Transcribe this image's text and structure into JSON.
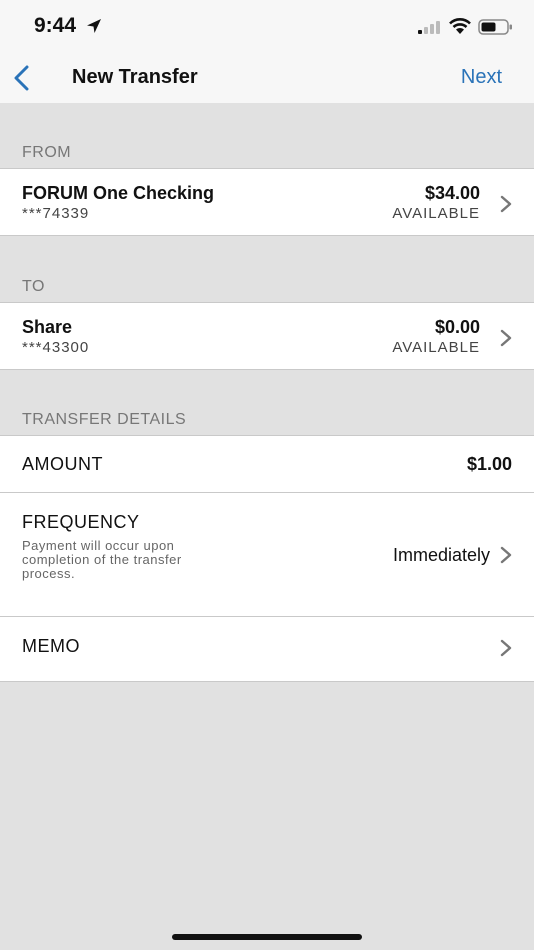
{
  "status_bar": {
    "time": "9:44"
  },
  "nav": {
    "title": "New Transfer",
    "next_label": "Next"
  },
  "from": {
    "header": "FROM",
    "account_name": "FORUM One Checking",
    "account_number": "***74339",
    "balance": "$34.00",
    "balance_label": "AVAILABLE"
  },
  "to": {
    "header": "TO",
    "account_name": "Share",
    "account_number": "***43300",
    "balance": "$0.00",
    "balance_label": "AVAILABLE"
  },
  "details": {
    "header": "TRANSFER DETAILS",
    "amount_label": "AMOUNT",
    "amount_value": "$1.00",
    "frequency_label": "FREQUENCY",
    "frequency_description": "Payment will occur upon completion of the transfer process.",
    "frequency_value": "Immediately",
    "memo_label": "MEMO"
  },
  "colors": {
    "accent": "#2a73b8",
    "background": "#e1e1e1"
  },
  "icons": [
    "location-arrow-icon",
    "signal-icon",
    "wifi-icon",
    "battery-icon",
    "chevron-left-icon",
    "chevron-right-icon"
  ]
}
